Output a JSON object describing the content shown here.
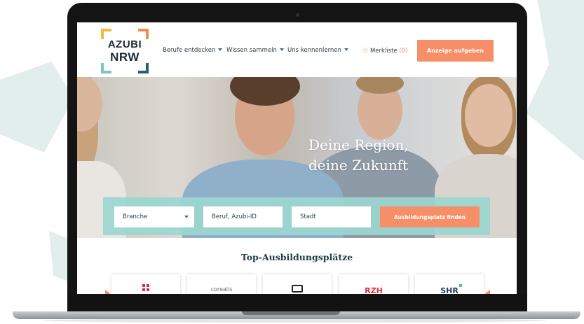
{
  "brand": {
    "line1": "AZUBI",
    "line2": "NRW"
  },
  "nav": {
    "items": [
      {
        "label": "Berufe entdecken"
      },
      {
        "label": "Wissen sammeln"
      },
      {
        "label": "Uns kennenlernen"
      }
    ],
    "merkliste_label": "Merkliste",
    "merkliste_count": "(0)",
    "cta_label": "Anzeige aufgeben"
  },
  "hero": {
    "headline_line1": "Deine Region,",
    "headline_line2": "deine Zukunft"
  },
  "search": {
    "branche_label": "Branche",
    "beruf_placeholder": "Beruf, Azubi-ID",
    "stadt_placeholder": "Stadt",
    "submit_label": "Ausbildungsplatz finden"
  },
  "section": {
    "title": "Top-Ausbildungsplätze",
    "cards": [
      {
        "name": "card-1",
        "logo_text": ""
      },
      {
        "name": "card-2",
        "logo_text": "corealis"
      },
      {
        "name": "card-3",
        "logo_text": ""
      },
      {
        "name": "card-4",
        "logo_text": "RZH"
      },
      {
        "name": "card-5",
        "logo_text": "SHR"
      }
    ]
  },
  "colors": {
    "accent": "#f68f67",
    "teal": "#9bd6d0",
    "dark_text": "#1f3b4a"
  }
}
